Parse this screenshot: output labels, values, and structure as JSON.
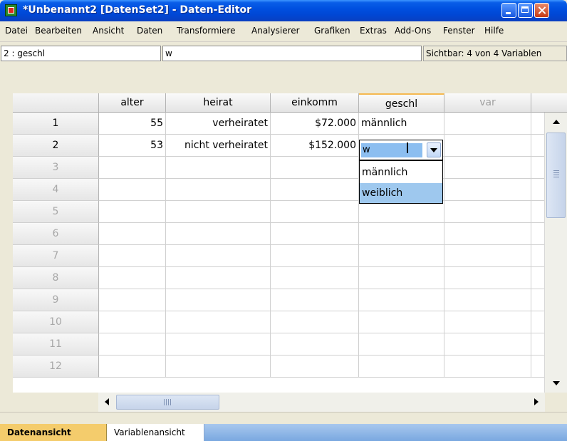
{
  "window": {
    "title": "*Unbenannt2 [DatenSet2] - Daten-Editor"
  },
  "menu": [
    "Datei",
    "Bearbeiten",
    "Ansicht",
    "Daten",
    "Transformiere",
    "Analysierer",
    "Grafiken",
    "Extras",
    "Add-Ons",
    "Fenster",
    "Hilfe"
  ],
  "cellbar": {
    "reference": "2 : geschl",
    "value": "w",
    "visible": "Sichtbar: 4 von 4 Variablen"
  },
  "grid": {
    "columns": [
      "alter",
      "heirat",
      "einkomm",
      "geschl",
      "var"
    ],
    "rows": [
      "1",
      "2",
      "3",
      "4",
      "5",
      "6",
      "7",
      "8",
      "9",
      "10",
      "11",
      "12"
    ],
    "data": [
      {
        "alter": "55",
        "heirat": "verheiratet",
        "einkomm": "$72.000",
        "geschl": "männlich"
      },
      {
        "alter": "53",
        "heirat": "nicht verheiratet",
        "einkomm": "$152.000",
        "geschl": ""
      }
    ]
  },
  "editor": {
    "text": "w",
    "options": [
      "männlich",
      "weiblich"
    ],
    "highlighted": 1
  },
  "tabs": {
    "data_view": "Datenansicht",
    "variable_view": "Variablenansicht"
  },
  "colors": {
    "title_blue": "#0050e0",
    "active_tab": "#f4cc6c",
    "highlight": "#9ec8ee"
  }
}
